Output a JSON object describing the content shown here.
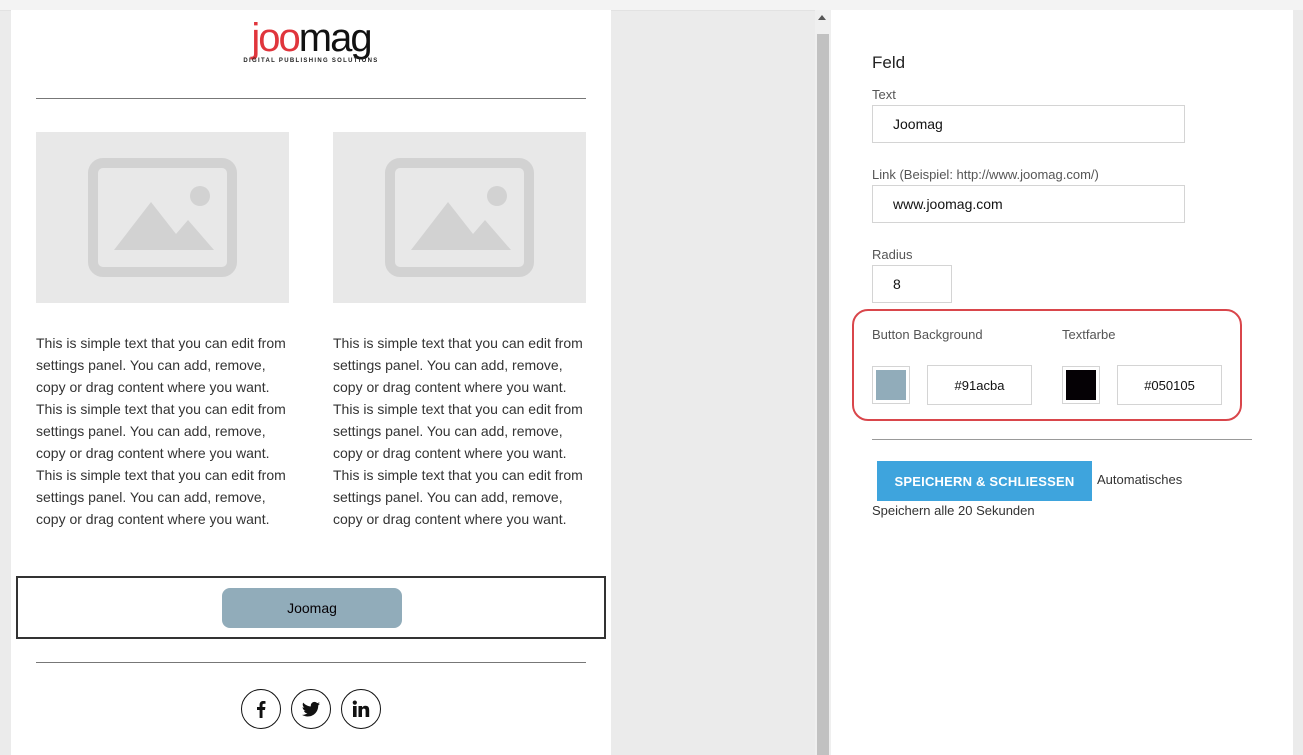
{
  "logo": {
    "word_part1": "joo",
    "word_part2": "mag",
    "tagline": "DIGITAL PUBLISHING SOLUTIONS"
  },
  "email": {
    "columns": [
      {
        "image_icon": "image-placeholder-icon",
        "text": "This is simple text that you can edit from settings panel. You can add, remove, copy or drag content where you want. This is simple text that you can edit from settings panel. You can add, remove, copy or drag content where you want. This is simple text that you can edit from settings panel. You can add, remove, copy or drag content where you want."
      },
      {
        "image_icon": "image-placeholder-icon",
        "text": "This is simple text that you can edit from settings panel. You can add, remove, copy or drag content where you want. This is simple text that you can edit from settings panel. You can add, remove, copy or drag content where you want. This is simple text that you can edit from settings panel. You can add, remove, copy or drag content where you want."
      }
    ],
    "button_label": "Joomag",
    "socials": [
      "facebook-icon",
      "twitter-icon",
      "linkedin-icon"
    ]
  },
  "panel": {
    "title": "Feld",
    "text_label": "Text",
    "text_value": "Joomag",
    "link_label": "Link (Beispiel: http://www.joomag.com/)",
    "link_value": "www.joomag.com",
    "radius_label": "Radius",
    "radius_value": "8",
    "bg_label": "Button Background",
    "bg_hex": "#91acba",
    "textcolor_label": "Textfarbe",
    "textcolor_hex": "#050105",
    "save_label": "SPEICHERN & SCHLIESSEN",
    "autosave_line1": "Automatisches",
    "autosave_line2": "Speichern alle 20 Sekunden"
  },
  "colors": {
    "button_bg": "#91acba",
    "button_text": "#050105",
    "save_button": "#3ea4dd",
    "highlight": "#d9464b",
    "logo_red": "#e0353c"
  }
}
